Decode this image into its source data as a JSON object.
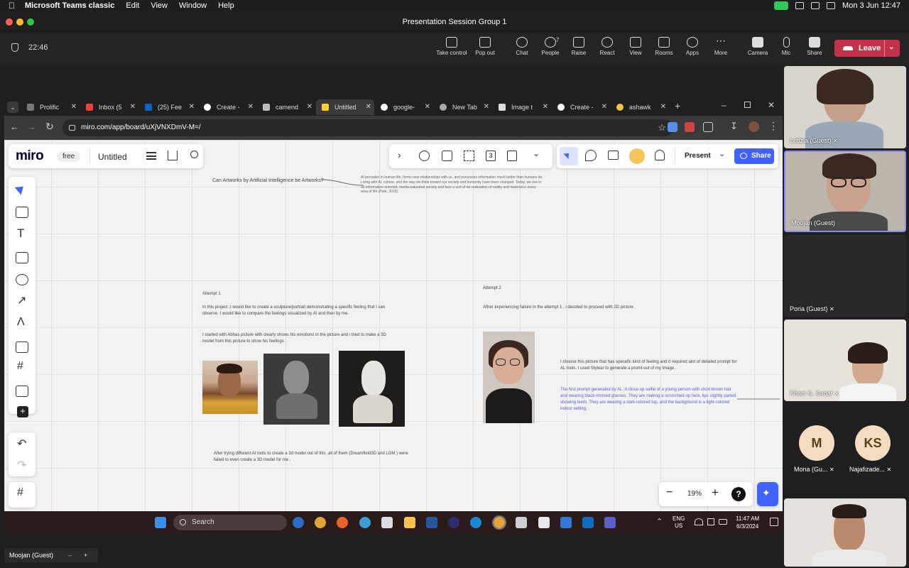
{
  "menubar": {
    "app": "Microsoft Teams classic",
    "items": [
      "Edit",
      "View",
      "Window",
      "Help"
    ],
    "datetime": "Mon 3 Jun  12:47"
  },
  "window": {
    "title": "Presentation Session Group 1"
  },
  "meeting": {
    "timer": "22:46",
    "leave_label": "Leave",
    "buttons": [
      {
        "label": "Take control",
        "icon": "take-control-icon"
      },
      {
        "label": "Pop out",
        "icon": "pop-out-icon"
      },
      {
        "label": "Chat",
        "icon": "chat-icon"
      },
      {
        "label": "People",
        "icon": "people-icon",
        "count": "7"
      },
      {
        "label": "Raise",
        "icon": "raise-hand-icon"
      },
      {
        "label": "React",
        "icon": "react-icon"
      },
      {
        "label": "View",
        "icon": "view-icon"
      },
      {
        "label": "Rooms",
        "icon": "rooms-icon"
      },
      {
        "label": "Apps",
        "icon": "apps-icon"
      },
      {
        "label": "More",
        "icon": "more-icon"
      },
      {
        "label": "Camera",
        "icon": "camera-icon"
      },
      {
        "label": "Mic",
        "icon": "mic-icon"
      },
      {
        "label": "Share",
        "icon": "share-icon"
      }
    ]
  },
  "browser": {
    "tabs": [
      "Prolific",
      "Inbox (5",
      "(25) Fee",
      "Create -",
      "camend",
      "Untitled",
      "google-",
      "New Tab",
      "Image t",
      "Create -",
      "ashawk"
    ],
    "active_tab": 5,
    "url": "miro.com/app/board/uXjVNXDmV-M=/"
  },
  "miro": {
    "logo": "miro",
    "plan": "free",
    "board_name": "Untitled",
    "present_label": "Present",
    "share_label": "Share",
    "zoom": "19%",
    "help": "?",
    "toolbar_count": "3",
    "board": {
      "question": "Can Artworks by Artificial Intelligence be Artworks?",
      "quote": "AI pervades in human life, forms new relationships with us, and processes information much better than humans do. Living with AI, culture, and the way we think toward our society and humanity have been changed. Today, we live in an information-oriented, media-saturated society and face a sort of de-realization of reality and material in every area of life (Park, 2019)",
      "attempt1_title": "Attempt 1",
      "attempt1_p1": "In this project ,I would like to create a sculpture/portrait demonstrating a specific feeling that I can observe. I would like to compare the feelings visualized by AI and then by me.",
      "attempt1_p2": "I started with Abhas picture with clearly shows his emotions in the picture and i tried to make a 3D model from this picture to show his feelings .",
      "attempt1_p3": "After trying different AI tools to create a 3d model out of this ,all of them (Dreamfield3D and LGM ) were failed to even create a 3D model for me .",
      "attempt2_title": "Attempt 2",
      "attempt2_p1": "Aftrer experiencing failure in the attempt 1 , i decided to proceed with 2D picture .",
      "attempt2_p2": "I choose this picture that has specefic kind of feeling and it required alot of detailed prompt for AL tools. I used Stylear to generate a promt out of my Image .",
      "attempt2_p3": "The first prompt generated by AL :A close-up selfie of a young person with short brown hair and wearing black-rimmed glasses. They are making a scrunched-up face, lips slightly parted showing teeth. They are wearing a dark-colored top, and the background is a light-colored indoor setting."
    }
  },
  "taskbar": {
    "search_placeholder": "Search",
    "time": "11:47 AM",
    "date": "6/3/2024",
    "lang": "ENG",
    "region": "US"
  },
  "participants": [
    {
      "name": "Letizia (Guest)"
    },
    {
      "name": "Moojan (Guest)"
    },
    {
      "name": "Poria (Guest)"
    },
    {
      "name": "Khani S, Sadaf"
    },
    {
      "name": "Mona (Gu...",
      "initials": "M"
    },
    {
      "name": "Najafizade...",
      "initials": "KS"
    }
  ],
  "self_view": {
    "name": "Moojan (Guest)"
  },
  "colors": {
    "leave": "#c4314b",
    "miro_share": "#4262ff",
    "active_speaker": "#8b8cf0"
  }
}
